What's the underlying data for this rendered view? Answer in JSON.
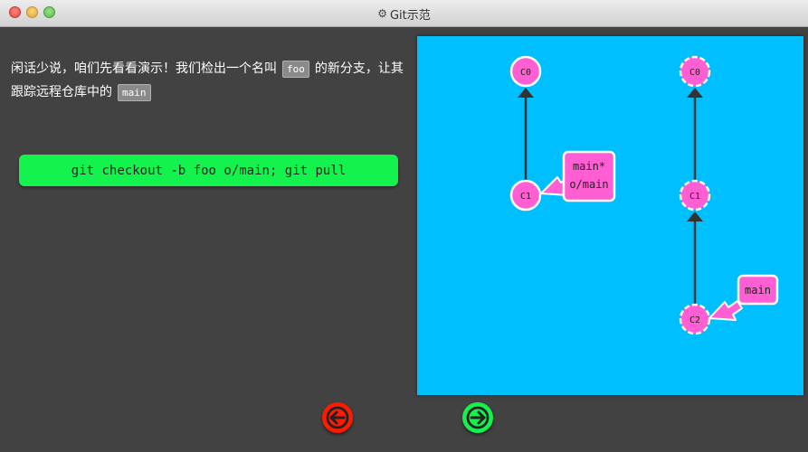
{
  "window": {
    "title": "Git示范"
  },
  "description": {
    "part1": "闲话少说，咱们先看看演示！我们检出一个名叫",
    "code1": "foo",
    "part2": "的新分支，让其跟踪远程仓库中的",
    "code2": "main"
  },
  "command": "git checkout -b foo o/main; git pull",
  "visualization": {
    "local": {
      "commits": [
        "C0",
        "C1"
      ],
      "branch_label_1": "main*",
      "branch_label_2": "o/main"
    },
    "remote": {
      "commits": [
        "C0",
        "C1",
        "C2"
      ],
      "branch_label": "main"
    }
  },
  "colors": {
    "canvas": "#00bfff",
    "commit": "#ff5fd2",
    "command_bg": "#14f24e",
    "back_button": "#ff1a00",
    "forward_button": "#14f24e"
  },
  "icons": [
    "gear-icon",
    "arrow-left-icon",
    "arrow-right-icon"
  ]
}
